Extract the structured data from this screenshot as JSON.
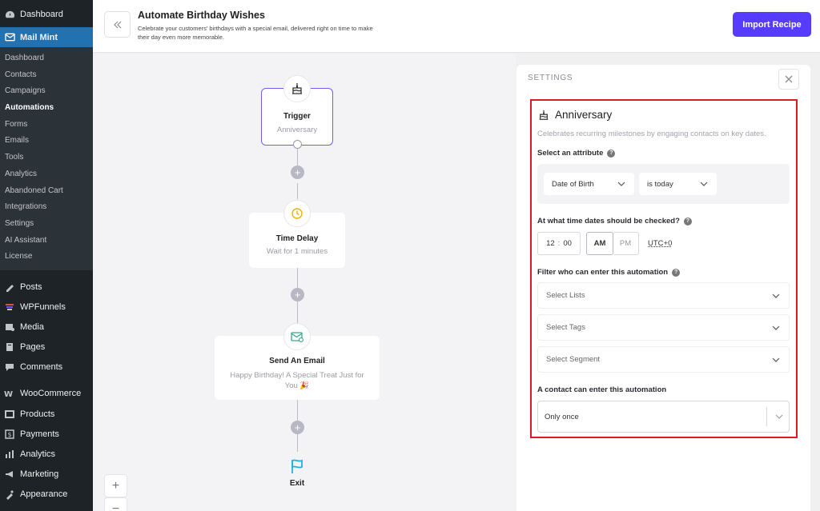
{
  "wp_sidebar": {
    "dashboard": "Dashboard",
    "mail_mint": "Mail Mint",
    "submenu": [
      "Dashboard",
      "Contacts",
      "Campaigns",
      "Automations",
      "Forms",
      "Emails",
      "Tools",
      "Analytics",
      "Abandoned Cart",
      "Integrations",
      "Settings",
      "AI Assistant",
      "License"
    ],
    "current_submenu": "Automations",
    "items_a": [
      "Posts",
      "WPFunnels",
      "Media",
      "Pages",
      "Comments"
    ],
    "items_b": [
      "WooCommerce",
      "Products",
      "Payments",
      "Analytics",
      "Marketing",
      "Appearance"
    ]
  },
  "header": {
    "title": "Automate Birthday Wishes",
    "subtitle": "Celebrate your customers' birthdays with a special email, delivered right on time to make their day even more memorable.",
    "import_label": "Import Recipe"
  },
  "canvas": {
    "trigger": {
      "title": "Trigger",
      "sub": "Anniversary"
    },
    "delay": {
      "title": "Time Delay",
      "sub": "Wait for 1 minutes"
    },
    "email": {
      "title": "Send An Email",
      "sub": "Happy Birthday! A Special Treat Just for You 🎉"
    },
    "exit": {
      "title": "Exit"
    },
    "zoom_in": "+",
    "zoom_out": "−"
  },
  "settings": {
    "label": "SETTINGS",
    "heading": "Anniversary",
    "description": "Celebrates recurring milestones by engaging contacts on key dates.",
    "attribute_label": "Select an attribute",
    "attribute_value": "Date of Birth",
    "condition_value": "is today",
    "time_label": "At what time dates should be checked?",
    "hour": "12",
    "minute": "00",
    "am": "AM",
    "pm": "PM",
    "timezone": "UTC+0",
    "filter_label": "Filter who can enter this automation",
    "lists_placeholder": "Select Lists",
    "tags_placeholder": "Select Tags",
    "segment_placeholder": "Select Segment",
    "entry_label": "A contact can enter this automation",
    "entry_value": "Only once"
  },
  "colors": {
    "brand": "#573bff",
    "highlight": "#d81b24",
    "wp_active": "#2271b1"
  }
}
